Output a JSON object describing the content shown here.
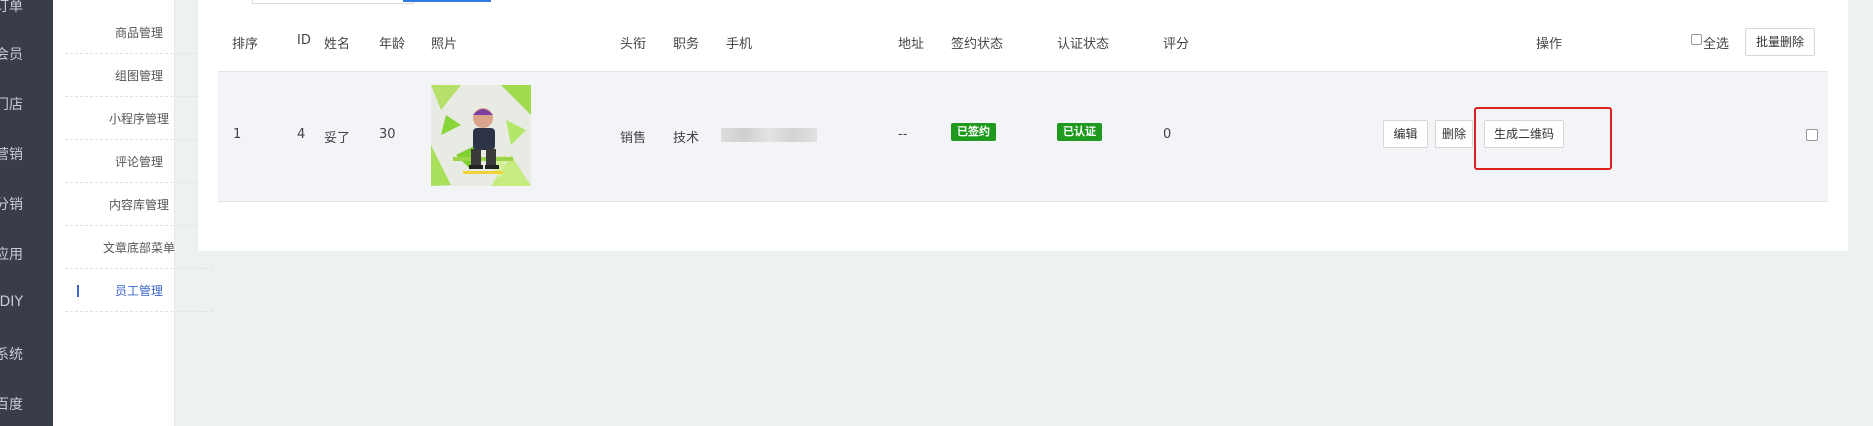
{
  "nav": {
    "items": [
      {
        "label": "订单"
      },
      {
        "label": "会员"
      },
      {
        "label": "门店"
      },
      {
        "label": "营销"
      },
      {
        "label": "分销"
      },
      {
        "label": "应用"
      },
      {
        "label": "DIY"
      },
      {
        "label": "系统"
      },
      {
        "label": "百度"
      }
    ]
  },
  "subnav": {
    "items": [
      {
        "label": "商品管理"
      },
      {
        "label": "组图管理"
      },
      {
        "label": "小程序管理"
      },
      {
        "label": "评论管理"
      },
      {
        "label": "内容库管理"
      },
      {
        "label": "文章底部菜单"
      },
      {
        "label": "员工管理",
        "active": true
      }
    ]
  },
  "table": {
    "headers": {
      "sort": "排序",
      "id": "ID",
      "name": "姓名",
      "age": "年龄",
      "photo": "照片",
      "title": "头衔",
      "position": "职务",
      "phone": "手机",
      "address": "地址",
      "sign_status": "签约状态",
      "auth_status": "认证状态",
      "score": "评分",
      "actions": "操作",
      "select_all": "全选"
    },
    "batch_delete": "批量删除",
    "row": {
      "sort": "1",
      "id": "4",
      "name": "妥了",
      "age": "30",
      "title": "销售",
      "position": "技术",
      "address": "--",
      "sign_status": "已签约",
      "auth_status": "已认证",
      "score": "0",
      "edit": "编辑",
      "delete": "删除",
      "gen_qr": "生成二维码"
    }
  },
  "colors": {
    "badge_green": "#1f9a1f",
    "highlight_red": "#e02020",
    "accent_blue": "#3b65c8"
  }
}
